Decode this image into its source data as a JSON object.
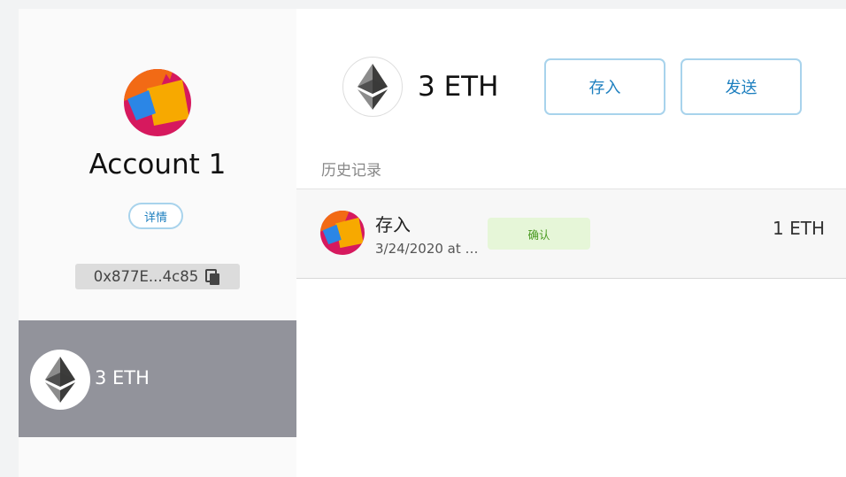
{
  "account": {
    "name": "Account 1",
    "details_label": "详情",
    "address": "0x877E...4c85",
    "asset_amount": "3 ETH"
  },
  "wallet": {
    "balance": "3 ETH",
    "deposit_label": "存入",
    "send_label": "发送"
  },
  "history": {
    "title": "历史记录",
    "transactions": [
      {
        "type": "存入",
        "date": "3/24/2020 at 1...",
        "status": "确认",
        "amount": "1 ETH"
      }
    ]
  },
  "colors": {
    "accent": "#1d7fbf",
    "button_border": "#a8d3ec",
    "status_bg": "#e6f6d8",
    "status_text": "#4a9a22",
    "selected_row": "#92939b"
  },
  "icons": [
    "identicon",
    "ethereum-logo-icon",
    "copy-icon"
  ]
}
